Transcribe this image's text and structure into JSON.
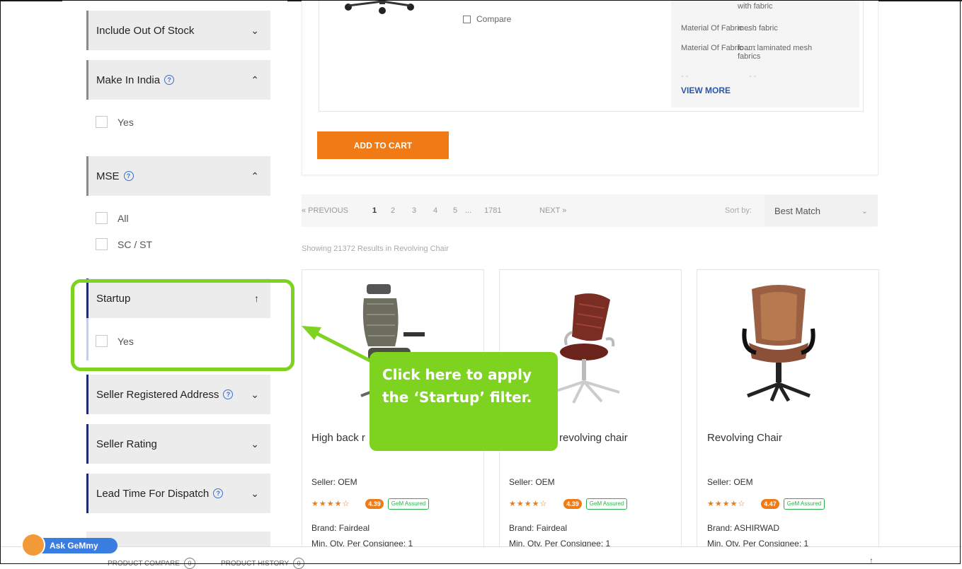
{
  "filters": [
    {
      "label": "Include Out Of Stock",
      "help": false,
      "state": "collapsed"
    },
    {
      "label": "Make In India",
      "help": true,
      "state": "expanded",
      "options": [
        "Yes"
      ]
    },
    {
      "label": "MSE",
      "help": true,
      "state": "expanded",
      "options": [
        "All",
        "SC / ST"
      ]
    },
    {
      "label": "Startup",
      "help": false,
      "state": "expanded",
      "options": [
        "Yes"
      ]
    },
    {
      "label": "Seller Registered Address",
      "help": true,
      "state": "collapsed"
    },
    {
      "label": "Seller Rating",
      "help": false,
      "state": "collapsed"
    },
    {
      "label": "Lead Time For Dispatch",
      "help": true,
      "state": "collapsed"
    }
  ],
  "top_product": {
    "compare_label": "Compare",
    "specs": [
      {
        "key": "",
        "value": "with fabric"
      },
      {
        "key": "Material Of Fabric ... :",
        "value": "mesh fabric"
      },
      {
        "key": "Material Of Fabric ... :",
        "value": "foam laminated mesh fabrics"
      }
    ],
    "view_more": "VIEW MORE",
    "add_to_cart": "ADD TO CART"
  },
  "pagination": {
    "previous": "« PREVIOUS",
    "pages": [
      "1",
      "2",
      "3",
      "4",
      "5",
      "...",
      "1781"
    ],
    "active_page": "1",
    "next": "NEXT »",
    "sort_label": "Sort by:",
    "sort_value": "Best Match"
  },
  "results_text": "Showing 21372 Results in Revolving Chair",
  "products": [
    {
      "title": "High back r",
      "seller": "Seller: OEM",
      "rating": "4.39",
      "brand": "Brand: Fairdeal",
      "min_qty": "Min. Qty. Per Consignee: 1"
    },
    {
      "title": "revolving chair",
      "seller": "Seller: OEM",
      "rating": "4.39",
      "brand": "Brand: Fairdeal",
      "min_qty": "Min. Qty. Per Consignee: 1"
    },
    {
      "title": "Revolving Chair",
      "seller": "Seller: OEM",
      "rating": "4.47",
      "brand": "Brand: ASHIRWAD",
      "min_qty": "Min. Qty. Per Consignee: 1"
    }
  ],
  "assured_label": "GeM Assured",
  "stars": "★★★★☆",
  "bottom": {
    "gemmy": "Ask GeMmy",
    "compare": "PRODUCT COMPARE",
    "compare_count": "0",
    "history": "PRODUCT HISTORY",
    "history_count": "0",
    "scroll_up": "↑"
  },
  "tutorial": {
    "callout_text": "Click here to apply the ‘Startup’ filter.",
    "color": "#7ed321"
  }
}
